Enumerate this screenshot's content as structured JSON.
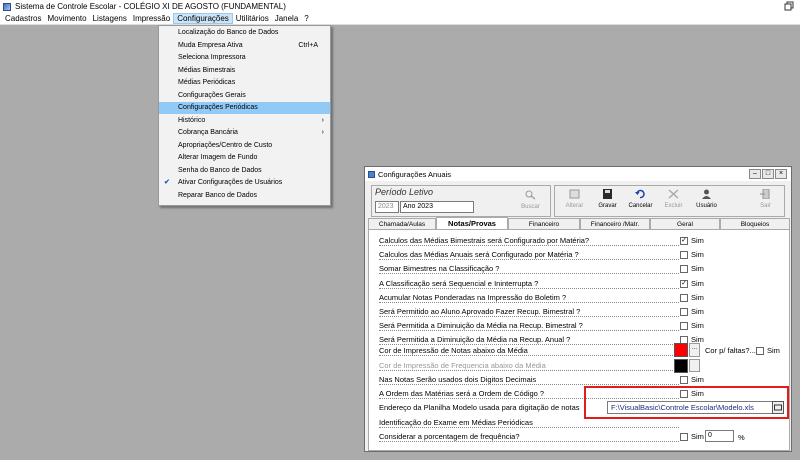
{
  "titlebar": {
    "title": "Sistema de Controle Escolar - COLÉGIO XI DE AGOSTO (FUNDAMENTAL)"
  },
  "menubar": [
    "Cadastros",
    "Movimento",
    "Listagens",
    "Impressão",
    "Configurações",
    "Utilitários",
    "Janela",
    "?"
  ],
  "dropdown": {
    "items": [
      {
        "label": "Localização do Banco de Dados"
      },
      {
        "label": "Muda Empresa Ativa",
        "shortcut": "Ctrl+A"
      },
      {
        "label": "Seleciona Impressora"
      },
      {
        "label": "Médias Bimestrais"
      },
      {
        "label": "Médias Periódicas"
      },
      {
        "label": "Configurações Gerais"
      },
      {
        "label": "Configurações Periódicas",
        "highlighted": true
      },
      {
        "label": "Histórico",
        "submenu": true
      },
      {
        "label": "Cobrança Bancária",
        "submenu": true
      },
      {
        "label": "Apropriações/Centro de Custo"
      },
      {
        "label": "Alterar Imagem de Fundo"
      },
      {
        "label": "Senha do Banco de Dados"
      },
      {
        "label": "Ativar Configurações de Usuários",
        "checked": true
      },
      {
        "label": "Reparar Banco de Dados"
      }
    ]
  },
  "window": {
    "title": "Configurações Anuais",
    "periodo": {
      "label": "Período Letivo",
      "code": "2023",
      "name": "Ano 2023"
    },
    "toolbar": {
      "buscar": "Buscar",
      "alterar": "Alterar",
      "gravar": "Gravar",
      "cancelar": "Cancelar",
      "excluir": "Excluir",
      "usuario": "Usuário",
      "sair": "Sair"
    },
    "tabs": [
      "Chamada/Aulas",
      "Notas/Provas",
      "Financeiro",
      "Financeiro /Matr.",
      "Geral",
      "Bloqueios"
    ],
    "rows": [
      {
        "label": "Calculos das Médias Bimestrais será Configurado por Matéria?",
        "checked": true
      },
      {
        "label": "Calculos das Médias Anuais será Configurado por Matéria ?",
        "checked": false
      },
      {
        "label": "Somar Bimestres na Classificação ?",
        "checked": false
      },
      {
        "label": "A Classificação será Sequencial e Ininterrupta ?",
        "checked": true
      },
      {
        "label": "Acumular Notas Ponderadas na Impressão do Boletim ?",
        "checked": false
      },
      {
        "label": "Será Permitido ao Aluno Aprovado Fazer Recup. Bimestral ?",
        "checked": false
      },
      {
        "label": "Será Permitida a Diminuição da Média na Recup. Bimestral ?",
        "checked": false
      },
      {
        "label": "Será Permitida a Diminuição da Média na Recup. Anual ?",
        "checked": false
      }
    ],
    "cor_notas": "Cor de Impressão de Notas abaixo da Média",
    "cor_faltas_label": "Cor p/ faltas?...",
    "cor_freq": "Cor de Impressão de Frequencia abaixo da Média",
    "row_digitos": "Nas Notas Serão usados dois Digitos Decimais",
    "row_ordem": "A Ordem das Matérias será a Ordem de Código ?",
    "row_endereco": "Endereço da Planilha Modelo usada para digitação de notas",
    "planilha_path": "F:\\VisualBasic\\Controle Escolar\\Modelo.xls",
    "row_identificacao": "Identificação do Exame em Médias Periódicas",
    "row_porcentagem": "Considerar a porcentagem de frequência?",
    "porcentagem_value": "0",
    "percent_sign": "%",
    "sim": "Sim",
    "colors": {
      "notas": "#ff0000",
      "freq": "#000000"
    }
  }
}
